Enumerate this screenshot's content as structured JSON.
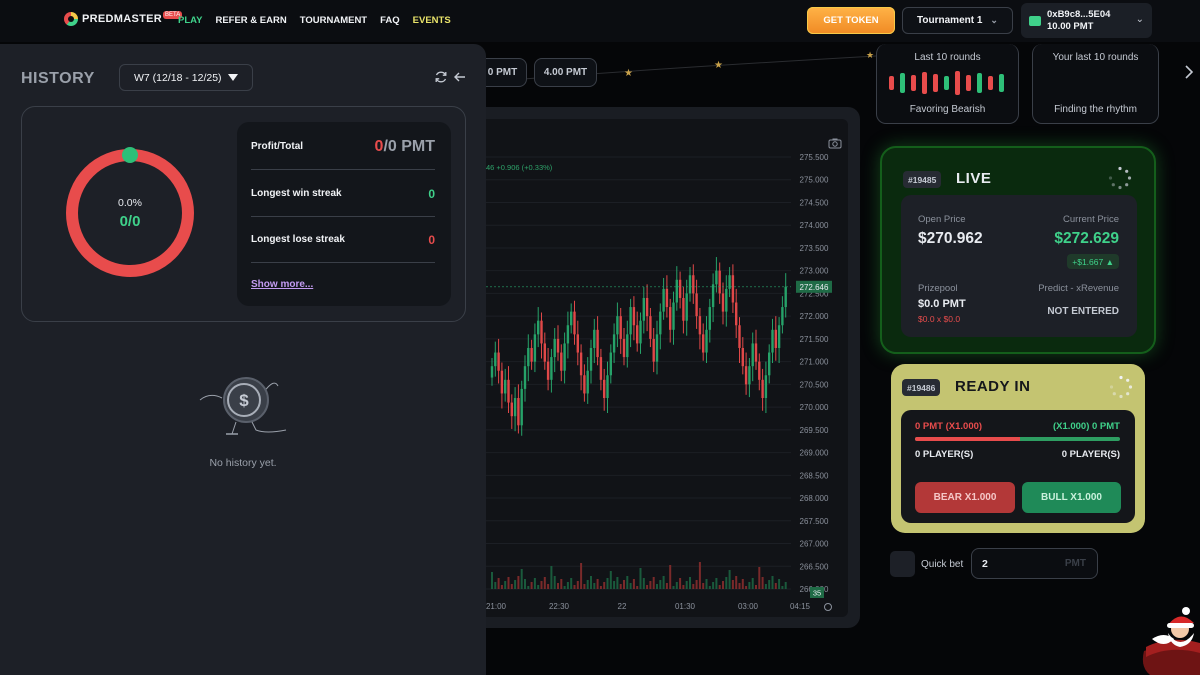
{
  "brand": {
    "name": "PREDMASTER",
    "badge": "BETA"
  },
  "nav": {
    "play": "PLAY",
    "refer": "REFER & EARN",
    "tournament": "TOURNAMENT",
    "faq": "FAQ",
    "events": "EVENTS"
  },
  "header": {
    "get_token": "GET TOKEN",
    "tournament_select": "Tournament 1",
    "wallet_address": "0xB9c8...5E04",
    "wallet_balance": "10.00 PMT"
  },
  "history": {
    "title": "HISTORY",
    "week": "W7 (12/18 - 12/25)",
    "win_rate": "0.0%",
    "win_ratio": "0/0",
    "profit_label": "Profit/Total",
    "profit_value_left": "0",
    "profit_value_right": "/0 PMT",
    "longest_win_label": "Longest win streak",
    "longest_win_value": "0",
    "longest_lose_label": "Longest lose streak",
    "longest_lose_value": "0",
    "show_more": "Show more...",
    "empty_text": "No history yet."
  },
  "amount_pills": [
    "0 PMT",
    "4.00 PMT"
  ],
  "chart": {
    "legend": "46 +0.906 (+0.33%)",
    "current_price_tag": "272.646",
    "volume_tag": "35",
    "colors": {
      "up": "#26a269",
      "down": "#e04848"
    }
  },
  "chart_data": {
    "type": "candlestick",
    "y_ticks": [
      "275.500",
      "275.000",
      "274.500",
      "274.000",
      "273.500",
      "273.000",
      "272.500",
      "272.000",
      "271.500",
      "271.000",
      "270.500",
      "270.000",
      "269.500",
      "269.000",
      "268.500",
      "268.000",
      "267.500",
      "267.000",
      "266.500",
      "266.000"
    ],
    "x_ticks": [
      "21:00",
      "22:30",
      "22",
      "01:30",
      "03:00",
      "04:15"
    ],
    "ylim": [
      266.0,
      275.5
    ],
    "close_series": [
      270.9,
      271.2,
      270.8,
      270.3,
      270.6,
      270.1,
      269.8,
      270.2,
      269.6,
      270.4,
      270.9,
      271.3,
      271.0,
      271.6,
      271.9,
      271.4,
      271.0,
      270.6,
      271.1,
      271.5,
      271.2,
      270.8,
      271.4,
      271.8,
      272.1,
      271.6,
      271.2,
      270.7,
      270.3,
      270.8,
      271.3,
      271.7,
      271.1,
      270.6,
      270.2,
      270.7,
      271.2,
      271.6,
      272.0,
      271.5,
      271.1,
      271.6,
      272.2,
      271.8,
      271.4,
      271.9,
      272.4,
      272.0,
      271.5,
      271.0,
      271.6,
      272.1,
      272.6,
      272.2,
      271.7,
      272.3,
      272.8,
      272.4,
      271.9,
      272.5,
      272.9,
      272.5,
      272.0,
      271.6,
      271.2,
      271.7,
      272.2,
      272.7,
      273.0,
      272.5,
      272.1,
      272.6,
      272.9,
      272.3,
      271.8,
      271.3,
      270.9,
      270.5,
      270.9,
      271.4,
      271.0,
      270.6,
      270.2,
      270.7,
      271.2,
      271.7,
      271.3,
      271.8,
      272.2,
      272.646
    ]
  },
  "rounds": {
    "last10_title": "Last 10 rounds",
    "last10_foot": "Favoring Bearish",
    "last10_results": [
      "down",
      "up",
      "down",
      "down",
      "down",
      "up",
      "down",
      "down",
      "up",
      "down",
      "up"
    ],
    "your10_title": "Your last 10 rounds",
    "your10_foot": "Finding the rhythm"
  },
  "live": {
    "round_id": "#19485",
    "title": "LIVE",
    "open_label": "Open Price",
    "open_value": "$270.962",
    "current_label": "Current Price",
    "current_value": "$272.629",
    "delta": "+$1.667 ▲",
    "prize_label": "Prizepool",
    "prize_value": "$0.0 PMT",
    "prize_sub": "$0.0 x $0.0",
    "predict_label": "Predict - xRevenue",
    "predict_value": "NOT ENTERED"
  },
  "ready": {
    "round_id": "#19486",
    "title": "READY IN",
    "bear_pool": "0 PMT (X1.000)",
    "bull_pool": "(X1.000) 0 PMT",
    "bear_players": "0 PLAYER(S)",
    "bull_players": "0 PLAYER(S)",
    "bear_button": "BEAR X1.000",
    "bull_button": "BULL X1.000",
    "colors": {
      "bear": "#e84c4c",
      "bull": "#3fd18a"
    }
  },
  "quick_bet": {
    "label": "Quick bet",
    "value": "2",
    "unit": "PMT"
  }
}
